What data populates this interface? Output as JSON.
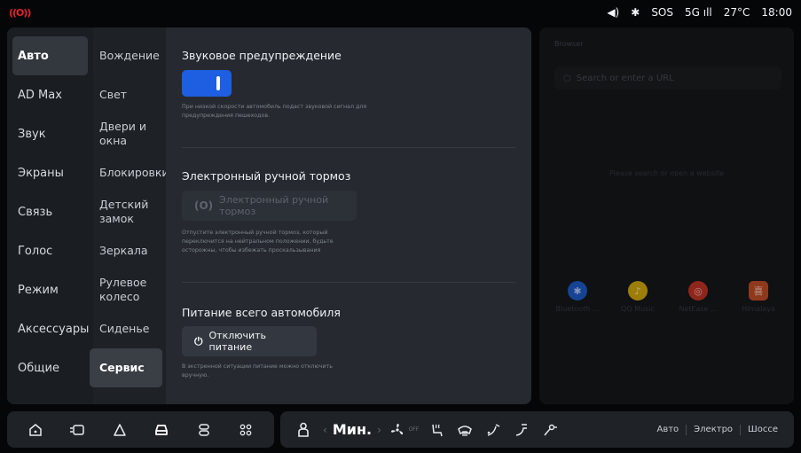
{
  "status_bar": {
    "left_icon": "((O))",
    "volume_icon": "◀)",
    "bluetooth_icon": "✱",
    "sos": "SOS",
    "network": "5G ıll",
    "temperature": "27°C",
    "time": "18:00"
  },
  "nav_primary": [
    {
      "label": "Авто",
      "active": true
    },
    {
      "label": "AD Max"
    },
    {
      "label": "Звук"
    },
    {
      "label": "Экраны"
    },
    {
      "label": "Связь"
    },
    {
      "label": "Голос"
    },
    {
      "label": "Режим"
    },
    {
      "label": "Аксессуары"
    },
    {
      "label": "Общие"
    }
  ],
  "nav_secondary": [
    {
      "label": "Вождение"
    },
    {
      "label": "Свет"
    },
    {
      "label": "Двери и окна"
    },
    {
      "label": "Блокировки"
    },
    {
      "label": "Детский замок"
    },
    {
      "label": "Зеркала"
    },
    {
      "label": "Рулевое колесо"
    },
    {
      "label": "Сиденье"
    },
    {
      "label": "Сервис",
      "active": true
    }
  ],
  "content": {
    "sound_warning": {
      "title": "Звуковое предупреждение",
      "enabled": true,
      "description": "При низкой скорости автомобиль подаст звуковой сигнал для предупреждения пешеходов."
    },
    "parking_brake": {
      "title": "Электронный ручной тормоз",
      "button_label": "Электронный ручной тормоз",
      "button_icon": "(O)",
      "description": "Отпустите электронный ручной тормоз, который переключится на нейтральном положении, будьте осторожны, чтобы избежать проскальзывания"
    },
    "vehicle_power": {
      "title": "Питание всего автомобиля",
      "button_label": "Отключить питание",
      "button_icon": "⏻",
      "description": "В экстренной ситуации питание можно отключить вручную."
    }
  },
  "browser": {
    "title": "Browser",
    "search_placeholder": "Search or enter a URL",
    "center_text": "Please search or open a website",
    "apps": [
      {
        "label": "Bluetooth ...",
        "icon": "✱",
        "color": "#1f5fd6"
      },
      {
        "label": "QQ Music",
        "icon": "♪",
        "color": "#e6b800"
      },
      {
        "label": "NetEase ...",
        "icon": "◎",
        "color": "#d83a2a"
      },
      {
        "label": "Himalaya",
        "icon": "喜",
        "color": "#e0552a"
      }
    ]
  },
  "dock": {
    "left_buttons": [
      {
        "name": "home-icon",
        "glyph": "⌂"
      },
      {
        "name": "display-icon",
        "glyph": "▭"
      },
      {
        "name": "navigation-icon",
        "glyph": "△"
      },
      {
        "name": "car-icon",
        "glyph": "⊖",
        "active": true
      },
      {
        "name": "seat-icon",
        "glyph": "☐"
      },
      {
        "name": "apps-grid-icon",
        "glyph": "▦"
      }
    ],
    "climate": {
      "seat_icon": "⌂",
      "fan_label": "Мин.",
      "fan_prev": "‹",
      "fan_next": "›",
      "fan_off_label": "OFF",
      "modes": [
        "Авто",
        "Электро",
        "Шоссе"
      ]
    }
  },
  "colors": {
    "accent": "#1d5fe0",
    "panel_bg": "#262a30",
    "nav_bg": "#1a1d21",
    "status_red": "#e0212a"
  }
}
